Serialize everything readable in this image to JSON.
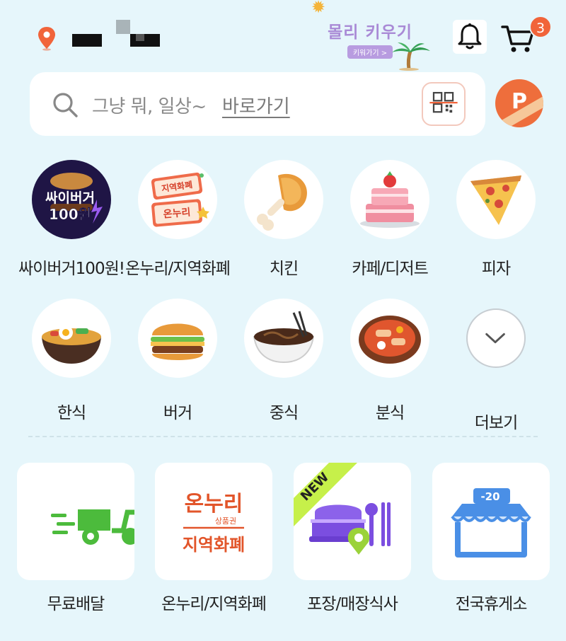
{
  "header": {
    "promo_title": "몰리 키우기",
    "promo_button": "키워가기 >",
    "cart_count": "3"
  },
  "search": {
    "placeholder": "그냥 뭐, 일상~",
    "link": "바로가기"
  },
  "points": {
    "letter": "P"
  },
  "categories": [
    {
      "label": "싸이버거100원!",
      "icon": "burger-promo-icon",
      "icon_text": [
        "싸이버거",
        "100원"
      ]
    },
    {
      "label": "온누리/지역화폐",
      "icon": "voucher-icon",
      "icon_text": [
        "지역화폐",
        "온누리"
      ]
    },
    {
      "label": "치킨",
      "icon": "chicken-icon"
    },
    {
      "label": "카페/디저트",
      "icon": "cake-icon"
    },
    {
      "label": "피자",
      "icon": "pizza-icon"
    },
    {
      "label": "한식",
      "icon": "bibimbap-icon"
    },
    {
      "label": "버거",
      "icon": "burger-icon"
    },
    {
      "label": "중식",
      "icon": "noodle-icon"
    },
    {
      "label": "분식",
      "icon": "tteokbokki-icon"
    },
    {
      "label": "더보기",
      "icon": "chevron-down-icon"
    }
  ],
  "services": [
    {
      "label": "무료배달",
      "icon": "delivery-scooter-icon",
      "color": "#4cbb3c"
    },
    {
      "label": "온누리/지역화폐",
      "icon": "onnuri-voucher-icon",
      "art_top": "온누리",
      "art_sub": "상품권",
      "art_bottom": "지역화폐",
      "color": "#e2552a"
    },
    {
      "label": "포장/매장식사",
      "icon": "takeout-icon",
      "badge": "NEW",
      "color": "#7b4ee0"
    },
    {
      "label": "전국휴게소",
      "icon": "rest-stop-icon",
      "art_tag": "-20",
      "color": "#4a8fe6"
    }
  ],
  "colors": {
    "background": "#e6f6fb",
    "accent": "#f1643a"
  }
}
